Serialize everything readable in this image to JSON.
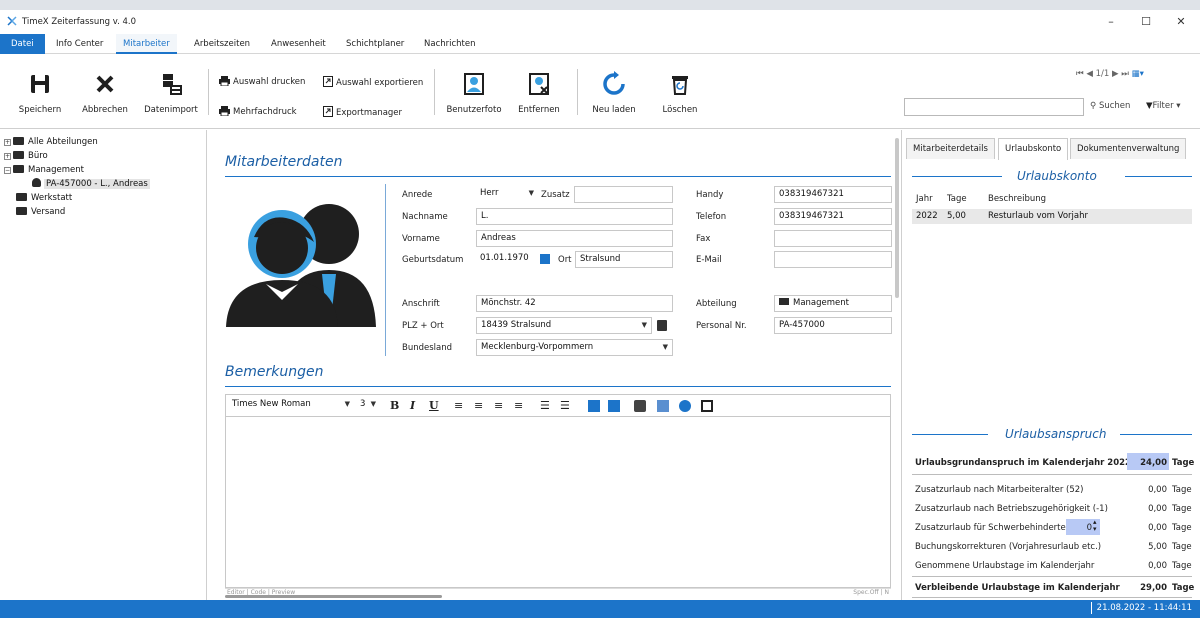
{
  "window": {
    "title": "TimeX Zeiterfassung v. 4.0",
    "minimize": "–",
    "maximize": "☐",
    "close": "✕"
  },
  "menu": [
    "Datei",
    "Info Center",
    "Mitarbeiter",
    "Arbeitszeiten",
    "Anwesenheit",
    "Schichtplaner",
    "Nachrichten"
  ],
  "toolbar": {
    "save": "Speichern",
    "cancel": "Abbrechen",
    "import": "Datenimport",
    "print_selection": "Auswahl drucken",
    "export_selection": "Auswahl exportieren",
    "multi_print": "Mehrfachdruck",
    "export_manager": "Exportmanager",
    "user_photo": "Benutzerfoto",
    "remove": "Entfernen",
    "reload": "Neu laden",
    "delete": "Löschen",
    "pager": "1/1",
    "search_label": "Suchen",
    "filter_label": "Filter",
    "search_value": ""
  },
  "tree": {
    "all": "Alle Abteilungen",
    "buero": "Büro",
    "management": "Management",
    "employee": "PA-457000 - L., Andreas",
    "werkstatt": "Werkstatt",
    "versand": "Versand"
  },
  "employee": {
    "section_title": "Mitarbeiterdaten",
    "labels": {
      "anrede": "Anrede",
      "zusatz": "Zusatz",
      "nachname": "Nachname",
      "vorname": "Vorname",
      "geburtsdatum": "Geburtsdatum",
      "ort": "Ort",
      "anschrift": "Anschrift",
      "plz_ort": "PLZ + Ort",
      "bundesland": "Bundesland",
      "handy": "Handy",
      "telefon": "Telefon",
      "fax": "Fax",
      "email": "E-Mail",
      "abteilung": "Abteilung",
      "personal_nr": "Personal Nr."
    },
    "values": {
      "anrede": "Herr",
      "zusatz": "",
      "nachname": "L.",
      "vorname": "Andreas",
      "geburtsdatum": "01.01.1970",
      "ort": "Stralsund",
      "anschrift": "Mönchstr. 42",
      "plz_ort": "18439 Stralsund",
      "bundesland": "Mecklenburg-Vorpommern",
      "handy": "038319467321",
      "telefon": "038319467321",
      "fax": "",
      "email": "",
      "abteilung": "Management",
      "personal_nr": "PA-457000"
    }
  },
  "remarks": {
    "section_title": "Bemerkungen",
    "font": "Times New Roman",
    "size": "3",
    "bold": "B",
    "italic": "I",
    "underline": "U",
    "footer": "Editor | Code | Preview",
    "footer_right": "Spec.Off | N"
  },
  "right": {
    "tabs": [
      "Mitarbeiterdetails",
      "Urlaubskonto",
      "Dokumentenverwaltung"
    ],
    "konto_title": "Urlaubskonto",
    "table_headers": [
      "Jahr",
      "Tage",
      "Beschreibung"
    ],
    "rows": [
      {
        "jahr": "2022",
        "tage": "5,00",
        "beschreibung": "Resturlaub vom Vorjahr"
      }
    ],
    "anspruch_title": "Urlaubsanspruch",
    "grund_label": "Urlaubsgrundanspruch im Kalenderjahr 2022",
    "grund_value": "24,00",
    "unit": "Tage",
    "items": [
      {
        "label": "Zusatzurlaub nach Mitarbeiteralter (52)",
        "value": "0,00"
      },
      {
        "label": "Zusatzurlaub nach Betriebszugehörigkeit (-1)",
        "value": "0,00"
      },
      {
        "label": "Zusatzurlaub für Schwerbehinderte",
        "value": "0,00",
        "spinner": "0"
      },
      {
        "label": "Buchungskorrekturen (Vorjahresurlaub etc.)",
        "value": "5,00"
      },
      {
        "label": "Genommene Urlaubstage im Kalenderjahr",
        "value": "0,00"
      }
    ],
    "remaining_label": "Verbleibende Urlaubstage im Kalenderjahr",
    "remaining_value": "29,00"
  },
  "status": {
    "datetime": "21.08.2022 - 11:44:11"
  },
  "colors": {
    "accent": "#1c74c9",
    "title_blue": "#1c5fa5",
    "highlight": "#b8c9f5",
    "avatar_blue": "#3aa0e0"
  }
}
